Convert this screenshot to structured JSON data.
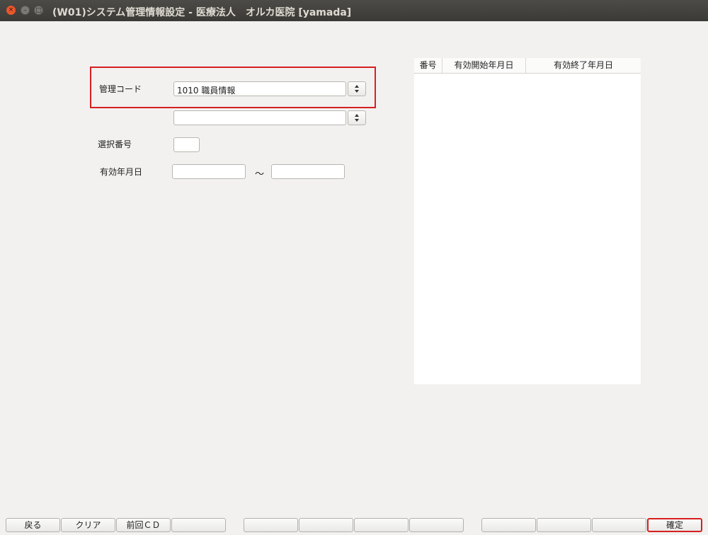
{
  "window": {
    "title": "(W01)システム管理情報設定 - 医療法人　オルカ医院 [yamada]"
  },
  "form": {
    "kanri_code_label": "管理コード",
    "kanri_code_value": "1010 職員情報",
    "sub_code_value": "",
    "sentaku_label": "選択番号",
    "sentaku_value": "",
    "yuko_label": "有効年月日",
    "yuko_from": "",
    "yuko_to": "",
    "tilde": "～"
  },
  "list": {
    "columns": [
      "番号",
      "有効開始年月日",
      "有効終了年月日"
    ],
    "rows": []
  },
  "footer": {
    "keys": [
      "戻る",
      "クリア",
      "前回ＣＤ",
      "",
      "",
      "",
      "",
      "",
      "",
      "",
      "",
      "確定"
    ]
  }
}
